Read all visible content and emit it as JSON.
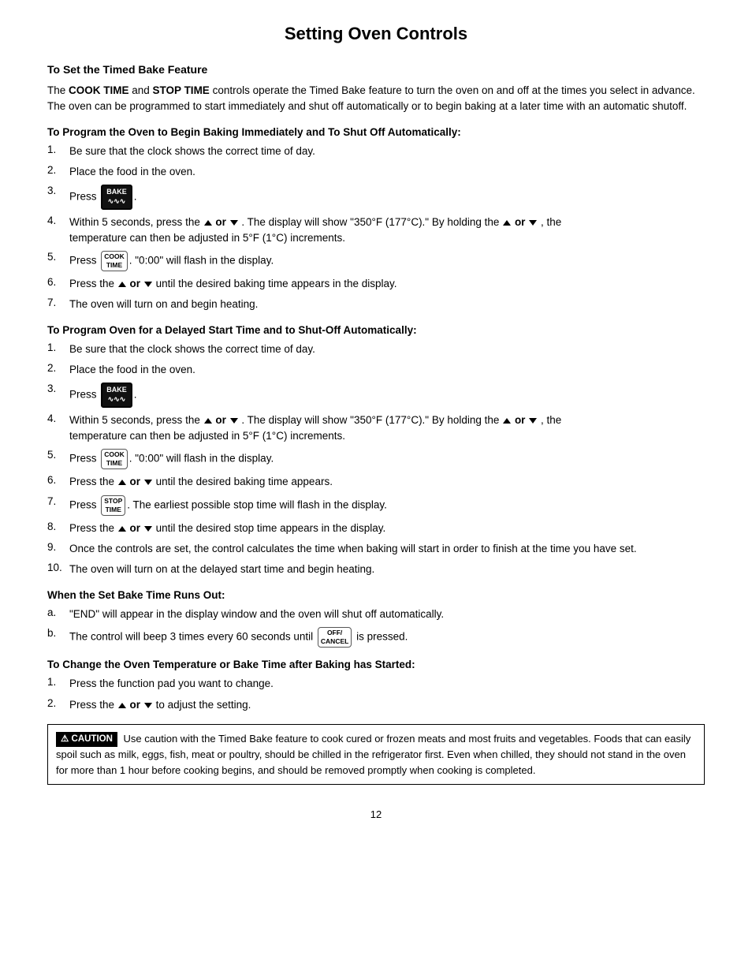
{
  "page": {
    "title": "Setting Oven Controls",
    "page_number": "12"
  },
  "sections": {
    "main_title": "To Set the Timed Bake Feature",
    "intro_text": "The COOK TIME and STOP TIME controls operate the Timed Bake feature to turn the oven on and off at the times you select in advance. The oven can be programmed to start immediately and shut off automatically or to begin baking at a later time with an automatic shutoff.",
    "section1_title": "To Program the Oven to Begin Baking Immediately and To Shut Off Automatically:",
    "section1_steps": [
      "Be sure that the clock shows the correct time of day.",
      "Place the food in the oven.",
      "Press [BAKE].",
      "Within 5 seconds, press the ↑ or ↓ . The display will show \"350°F (177°C).\" By holding the ↑ or ↓ , the temperature can then be adjusted in 5°F (1°C) increments.",
      "Press [COOK TIME]. \"0:00\" will flash in the display.",
      "Press the ↑ or ↓ until the desired baking time appears in the display.",
      "The oven will turn on and begin heating."
    ],
    "section2_title": "To Program Oven for a Delayed Start Time and to Shut-Off Automatically:",
    "section2_steps": [
      "Be sure that the clock shows the correct time of day.",
      "Place the food in the oven.",
      "Press [BAKE].",
      "Within 5 seconds, press the ↑ or ↓ . The display will show \"350°F (177°C).\" By holding the ↑ or ↓ , the temperature can then be adjusted in 5°F (1°C) increments.",
      "Press [COOK TIME]. \"0:00\" will flash in the display.",
      "Press the ↑ or ↓ until the desired baking time appears.",
      "Press [STOP TIME]. The earliest possible stop time will flash in the display.",
      "Press the ↑ or ↓ until the desired stop time appears in the display.",
      "Once the controls are set, the control calculates the time when baking will start in order to finish at the time you have set.",
      "The oven will turn on at the delayed start time and begin heating."
    ],
    "section3_title": "When the Set Bake Time Runs Out:",
    "section3_items": [
      "\"END\" will appear in the display window and the oven will shut off automatically.",
      "The control will beep 3 times every 60 seconds until [OFF/CANCEL] is pressed."
    ],
    "section4_title": "To Change the Oven Temperature or Bake Time after Baking has Started:",
    "section4_steps": [
      "Press the function pad you want to change.",
      "Press the ↑ or ↓ to adjust the setting."
    ],
    "caution_text": "Use caution with the Timed Bake feature to cook cured or frozen meats and most fruits and vegetables. Foods that can easily spoil such as milk, eggs, fish, meat or poultry, should be chilled in the refrigerator first. Even when chilled, they should not stand in the oven for more than 1 hour before cooking begins, and should be removed promptly when cooking is completed."
  }
}
